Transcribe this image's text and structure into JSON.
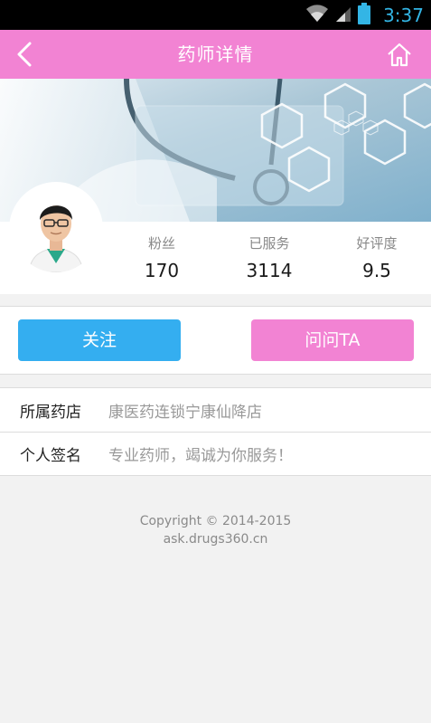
{
  "status_bar": {
    "time": "3:37",
    "icons": [
      "wifi-icon",
      "signal-icon",
      "battery-icon"
    ]
  },
  "header": {
    "title": "药师详情",
    "back_icon": "back-arrow-icon",
    "home_icon": "home-icon"
  },
  "profile": {
    "stats": [
      {
        "label": "粉丝",
        "value": "170"
      },
      {
        "label": "已服务",
        "value": "3114"
      },
      {
        "label": "好评度",
        "value": "9.5"
      }
    ]
  },
  "actions": {
    "follow_label": "关注",
    "ask_label": "问问TA"
  },
  "info": [
    {
      "key": "所属药店",
      "value": "康医药连锁宁康仙降店"
    },
    {
      "key": "个人签名",
      "value": "专业药师，竭诚为你服务！"
    }
  ],
  "footer": {
    "copyright": "Copyright © 2014-2015",
    "site": "ask.drugs360.cn"
  },
  "colors": {
    "header": "#f283d3",
    "follow_button": "#34aef0",
    "ask_button": "#f283d3",
    "status_time": "#33b5e5"
  }
}
